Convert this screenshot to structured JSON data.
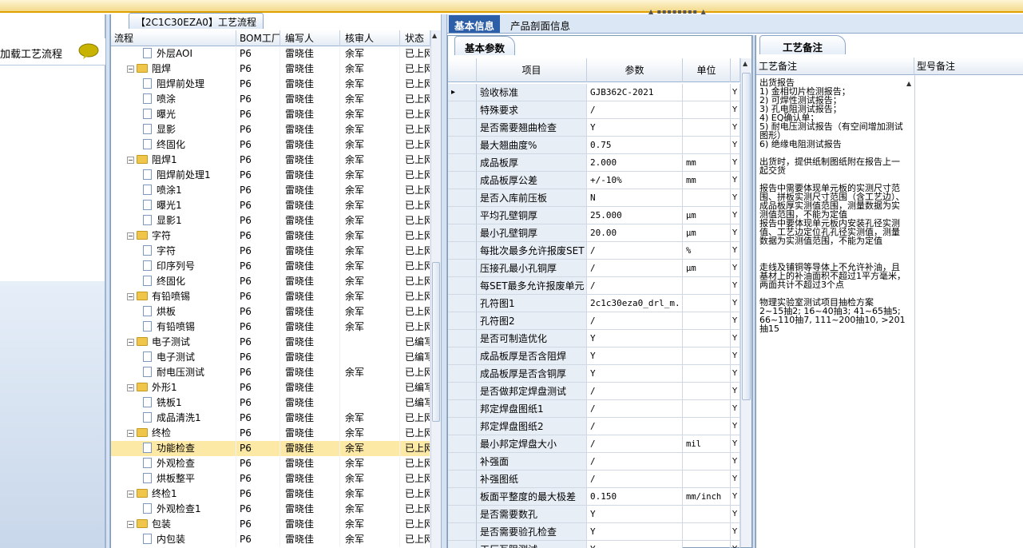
{
  "left": {
    "load_text": "加载工艺流程"
  },
  "tree": {
    "tab_title": "【2C1C30EZA0】工艺流程",
    "headers": {
      "process": "流程",
      "bom": "BOM工厂",
      "writer": "编写人",
      "reviewer": "核审人",
      "status": "状态"
    },
    "rows": [
      {
        "name": "外层AOI",
        "type": "doc",
        "bom": "P6",
        "writer": "雷晓佳",
        "reviewer": "余军",
        "status": "已上网"
      },
      {
        "name": "阻焊",
        "type": "folder",
        "bom": "P6",
        "writer": "雷晓佳",
        "reviewer": "余军",
        "status": "已上网"
      },
      {
        "name": "阻焊前处理",
        "type": "doc",
        "bom": "P6",
        "writer": "雷晓佳",
        "reviewer": "余军",
        "status": "已上网"
      },
      {
        "name": "喷涂",
        "type": "doc",
        "bom": "P6",
        "writer": "雷晓佳",
        "reviewer": "余军",
        "status": "已上网"
      },
      {
        "name": "曝光",
        "type": "doc",
        "bom": "P6",
        "writer": "雷晓佳",
        "reviewer": "余军",
        "status": "已上网"
      },
      {
        "name": "显影",
        "type": "doc",
        "bom": "P6",
        "writer": "雷晓佳",
        "reviewer": "余军",
        "status": "已上网"
      },
      {
        "name": "终固化",
        "type": "doc",
        "bom": "P6",
        "writer": "雷晓佳",
        "reviewer": "余军",
        "status": "已上网"
      },
      {
        "name": "阻焊1",
        "type": "folder",
        "bom": "P6",
        "writer": "雷晓佳",
        "reviewer": "余军",
        "status": "已上网"
      },
      {
        "name": "阻焊前处理1",
        "type": "doc",
        "bom": "P6",
        "writer": "雷晓佳",
        "reviewer": "余军",
        "status": "已上网"
      },
      {
        "name": "喷涂1",
        "type": "doc",
        "bom": "P6",
        "writer": "雷晓佳",
        "reviewer": "余军",
        "status": "已上网"
      },
      {
        "name": "曝光1",
        "type": "doc",
        "bom": "P6",
        "writer": "雷晓佳",
        "reviewer": "余军",
        "status": "已上网"
      },
      {
        "name": "显影1",
        "type": "doc",
        "bom": "P6",
        "writer": "雷晓佳",
        "reviewer": "余军",
        "status": "已上网"
      },
      {
        "name": "字符",
        "type": "folder",
        "bom": "P6",
        "writer": "雷晓佳",
        "reviewer": "余军",
        "status": "已上网"
      },
      {
        "name": "字符",
        "type": "doc",
        "bom": "P6",
        "writer": "雷晓佳",
        "reviewer": "余军",
        "status": "已上网"
      },
      {
        "name": "印序列号",
        "type": "doc",
        "bom": "P6",
        "writer": "雷晓佳",
        "reviewer": "余军",
        "status": "已上网"
      },
      {
        "name": "终固化",
        "type": "doc",
        "bom": "P6",
        "writer": "雷晓佳",
        "reviewer": "余军",
        "status": "已上网"
      },
      {
        "name": "有铅喷锡",
        "type": "folder",
        "bom": "P6",
        "writer": "雷晓佳",
        "reviewer": "余军",
        "status": "已上网"
      },
      {
        "name": "烘板",
        "type": "doc",
        "bom": "P6",
        "writer": "雷晓佳",
        "reviewer": "余军",
        "status": "已上网"
      },
      {
        "name": "有铅喷锡",
        "type": "doc",
        "bom": "P6",
        "writer": "雷晓佳",
        "reviewer": "余军",
        "status": "已上网"
      },
      {
        "name": "电子测试",
        "type": "folder",
        "bom": "P6",
        "writer": "雷晓佳",
        "reviewer": "",
        "status": "已编写"
      },
      {
        "name": "电子测试",
        "type": "doc",
        "bom": "P6",
        "writer": "雷晓佳",
        "reviewer": "",
        "status": "已编写"
      },
      {
        "name": "耐电压测试",
        "type": "doc",
        "bom": "P6",
        "writer": "雷晓佳",
        "reviewer": "余军",
        "status": "已上网"
      },
      {
        "name": "外形1",
        "type": "folder",
        "bom": "P6",
        "writer": "雷晓佳",
        "reviewer": "",
        "status": "已编写"
      },
      {
        "name": "铣板1",
        "type": "doc",
        "bom": "P6",
        "writer": "雷晓佳",
        "reviewer": "",
        "status": "已编写"
      },
      {
        "name": "成品清洗1",
        "type": "doc",
        "bom": "P6",
        "writer": "雷晓佳",
        "reviewer": "余军",
        "status": "已上网"
      },
      {
        "name": "终检",
        "type": "folder",
        "bom": "P6",
        "writer": "雷晓佳",
        "reviewer": "余军",
        "status": "已上网"
      },
      {
        "name": "功能检查",
        "type": "doc",
        "bom": "P6",
        "writer": "雷晓佳",
        "reviewer": "余军",
        "status": "已上网",
        "selected": true
      },
      {
        "name": "外观检查",
        "type": "doc",
        "bom": "P6",
        "writer": "雷晓佳",
        "reviewer": "余军",
        "status": "已上网"
      },
      {
        "name": "烘板整平",
        "type": "doc",
        "bom": "P6",
        "writer": "雷晓佳",
        "reviewer": "余军",
        "status": "已上网"
      },
      {
        "name": "终检1",
        "type": "folder",
        "bom": "P6",
        "writer": "雷晓佳",
        "reviewer": "余军",
        "status": "已上网"
      },
      {
        "name": "外观检查1",
        "type": "doc",
        "bom": "P6",
        "writer": "雷晓佳",
        "reviewer": "余军",
        "status": "已上网"
      },
      {
        "name": "包装",
        "type": "folder",
        "bom": "P6",
        "writer": "雷晓佳",
        "reviewer": "余军",
        "status": "已上网"
      },
      {
        "name": "内包装",
        "type": "doc",
        "bom": "P6",
        "writer": "雷晓佳",
        "reviewer": "余军",
        "status": "已上网"
      }
    ]
  },
  "tabs": {
    "basic": "基本信息",
    "profile": "产品剖面信息"
  },
  "params": {
    "subtab": "基本参数",
    "headers": {
      "item": "项目",
      "value": "参数",
      "unit": "单位"
    },
    "rows": [
      {
        "item": "验收标准",
        "value": "GJB362C-2021",
        "unit": "",
        "flag": "Y"
      },
      {
        "item": "特殊要求",
        "value": "/",
        "unit": "",
        "flag": "Y"
      },
      {
        "item": "是否需要翘曲检查",
        "value": "Y",
        "unit": "",
        "flag": "Y"
      },
      {
        "item": "最大翘曲度%",
        "value": "0.75",
        "unit": "",
        "flag": "Y"
      },
      {
        "item": "成品板厚",
        "value": "2.000",
        "unit": "mm",
        "flag": "Y"
      },
      {
        "item": "成品板厚公差",
        "value": "+/-10%",
        "unit": "mm",
        "flag": "Y"
      },
      {
        "item": "是否入库前压板",
        "value": "N",
        "unit": "",
        "flag": "Y"
      },
      {
        "item": "平均孔壁铜厚",
        "value": "25.000",
        "unit": "μm",
        "flag": "Y"
      },
      {
        "item": "最小孔壁铜厚",
        "value": "20.00",
        "unit": "μm",
        "flag": "Y"
      },
      {
        "item": "每批次最多允许报废SET",
        "value": "/",
        "unit": "%",
        "flag": "Y"
      },
      {
        "item": "压接孔最小孔铜厚",
        "value": "/",
        "unit": "μm",
        "flag": "Y"
      },
      {
        "item": "每SET最多允许报废单元",
        "value": "/",
        "unit": "",
        "flag": "Y"
      },
      {
        "item": "孔符图1",
        "value": "2c1c30eza0_drl_m...",
        "unit": "",
        "flag": "Y"
      },
      {
        "item": "孔符图2",
        "value": "/",
        "unit": "",
        "flag": "Y"
      },
      {
        "item": "是否可制造优化",
        "value": "Y",
        "unit": "",
        "flag": "Y"
      },
      {
        "item": "成品板厚是否含阻焊",
        "value": "Y",
        "unit": "",
        "flag": "Y"
      },
      {
        "item": "成品板厚是否含铜厚",
        "value": "Y",
        "unit": "",
        "flag": "Y"
      },
      {
        "item": "是否做邦定焊盘测试",
        "value": "/",
        "unit": "",
        "flag": "Y"
      },
      {
        "item": "邦定焊盘图纸1",
        "value": "/",
        "unit": "",
        "flag": "Y"
      },
      {
        "item": "邦定焊盘图纸2",
        "value": "/",
        "unit": "",
        "flag": "Y"
      },
      {
        "item": "最小邦定焊盘大小",
        "value": "/",
        "unit": "mil",
        "flag": "Y"
      },
      {
        "item": "补强面",
        "value": "/",
        "unit": "",
        "flag": "Y"
      },
      {
        "item": "补强图纸",
        "value": "/",
        "unit": "",
        "flag": "Y"
      },
      {
        "item": "板面平整度的最大极差",
        "value": "0.150",
        "unit": "mm/inch",
        "flag": "Y"
      },
      {
        "item": "是否需要数孔",
        "value": "Y",
        "unit": "",
        "flag": "Y"
      },
      {
        "item": "是否需要验孔检查",
        "value": "Y",
        "unit": "",
        "flag": "Y"
      },
      {
        "item": "工厂互阻测试",
        "value": "Y",
        "unit": "",
        "flag": "Y"
      }
    ]
  },
  "notes": {
    "tab": "工艺备注",
    "col1": "工艺备注",
    "col2": "型号备注",
    "text": "出货报告\n1) 金相切片检测报告；\n2) 可焊性测试报告；\n3) 孔电阻测试报告；\n4) EQ确认单；\n5) 耐电压测试报告（有空间增加测试图形）\n6) 绝缘电阻测试报告\n\n出货时，提供纸制图纸附在报告上一起交货\n\n报告中需要体现单元板的实测尺寸范围、拼板实测尺寸范围（含工艺边）、成品板厚实测值范围，测量数据为实测值范围，不能为定值\n报告中要体现单元板内安装孔径实测值、工艺边定位孔孔径实测值，测量数据为实测值范围，不能为定值\n\n\n走线及铺铜等导体上不允许补油，且基材上的补油面积不超过1平方毫米，两面共计不超过3个点\n\n物理实验室测试项目抽检方案\n2~15抽2; 16~40抽3; 41~65抽5; 66~110抽7, 111~200抽10, >201抽15"
  }
}
